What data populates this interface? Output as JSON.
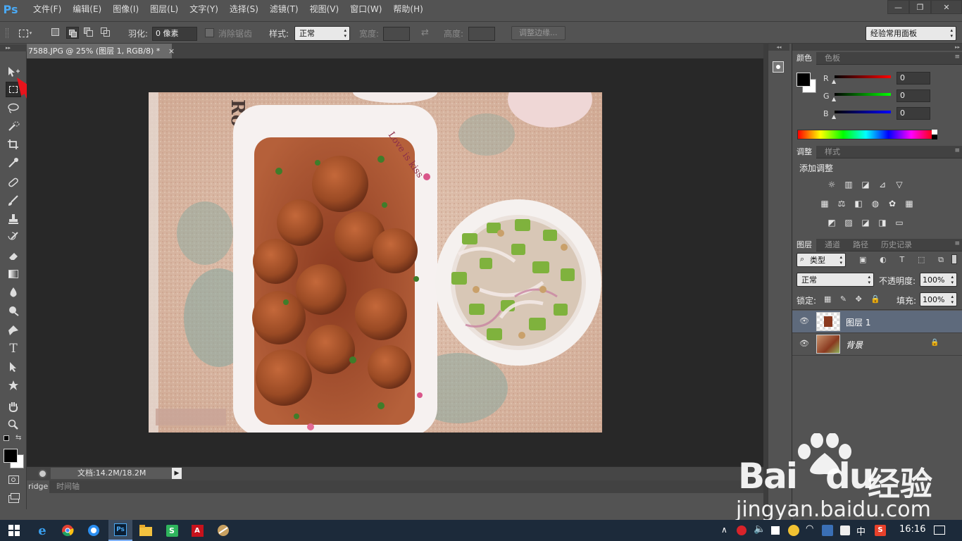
{
  "app": {
    "logo": "Ps"
  },
  "menu": [
    "文件(F)",
    "编辑(E)",
    "图像(I)",
    "图层(L)",
    "文字(Y)",
    "选择(S)",
    "滤镜(T)",
    "视图(V)",
    "窗口(W)",
    "帮助(H)"
  ],
  "window_controls": {
    "minimize": "—",
    "restore": "❐",
    "close": "✕"
  },
  "options": {
    "feather_label": "羽化:",
    "feather_value": "0 像素",
    "antialias_label": "消除锯齿",
    "style_label": "样式:",
    "style_value": "正常",
    "width_label": "宽度:",
    "height_label": "高度:",
    "refine_edge": "调整边缘...",
    "workspace": "经验常用面板"
  },
  "document": {
    "tab_title": "7588.JPG @ 25% (图层 1, RGB/8) *",
    "tab_close": "×",
    "status": "文档:14.2M/18.2M"
  },
  "bottom_tabs": [
    "ridge",
    "时间轴"
  ],
  "color_panel": {
    "tabs": [
      "颜色",
      "色板"
    ],
    "channels": [
      {
        "label": "R",
        "value": "0",
        "color": "#ff0000"
      },
      {
        "label": "G",
        "value": "0",
        "color": "#00ff00"
      },
      {
        "label": "B",
        "value": "0",
        "color": "#0000ff"
      }
    ]
  },
  "adjust_panel": {
    "tabs": [
      "调整",
      "样式"
    ],
    "title": "添加调整",
    "row1": [
      "☼",
      "▥",
      "◪",
      "⊿",
      "▽"
    ],
    "row2": [
      "▦",
      "⚖",
      "◧",
      "◍",
      "✿",
      "▦"
    ],
    "row3": [
      "◩",
      "▨",
      "◪",
      "◨",
      "▭"
    ]
  },
  "layers_panel": {
    "tabs": [
      "图层",
      "通道",
      "路径",
      "历史记录"
    ],
    "filter_label": "类型",
    "blend_mode": "正常",
    "opacity_label": "不透明度:",
    "opacity_value": "100%",
    "lock_label": "锁定:",
    "fill_label": "填充:",
    "fill_value": "100%",
    "layers": [
      {
        "name": "图层 1",
        "visible": true,
        "selected": true,
        "locked": false
      },
      {
        "name": "背景",
        "visible": true,
        "selected": false,
        "locked": true
      }
    ]
  },
  "watermark": {
    "brand": "Bai",
    "brand2": "du",
    "brand_cn": "经验",
    "url": "jingyan.baidu.com"
  },
  "taskbar": {
    "time": "16:16",
    "ime": "中",
    "apps": [
      "ie",
      "chrome",
      "qq-browser",
      "photoshop",
      "file-explorer",
      "wps",
      "acrobat",
      "misc"
    ]
  },
  "colors": {
    "accent": "#4aa9f4",
    "annotation_arrow": "#e8141c",
    "selected_layer": "#5e6a7c"
  }
}
